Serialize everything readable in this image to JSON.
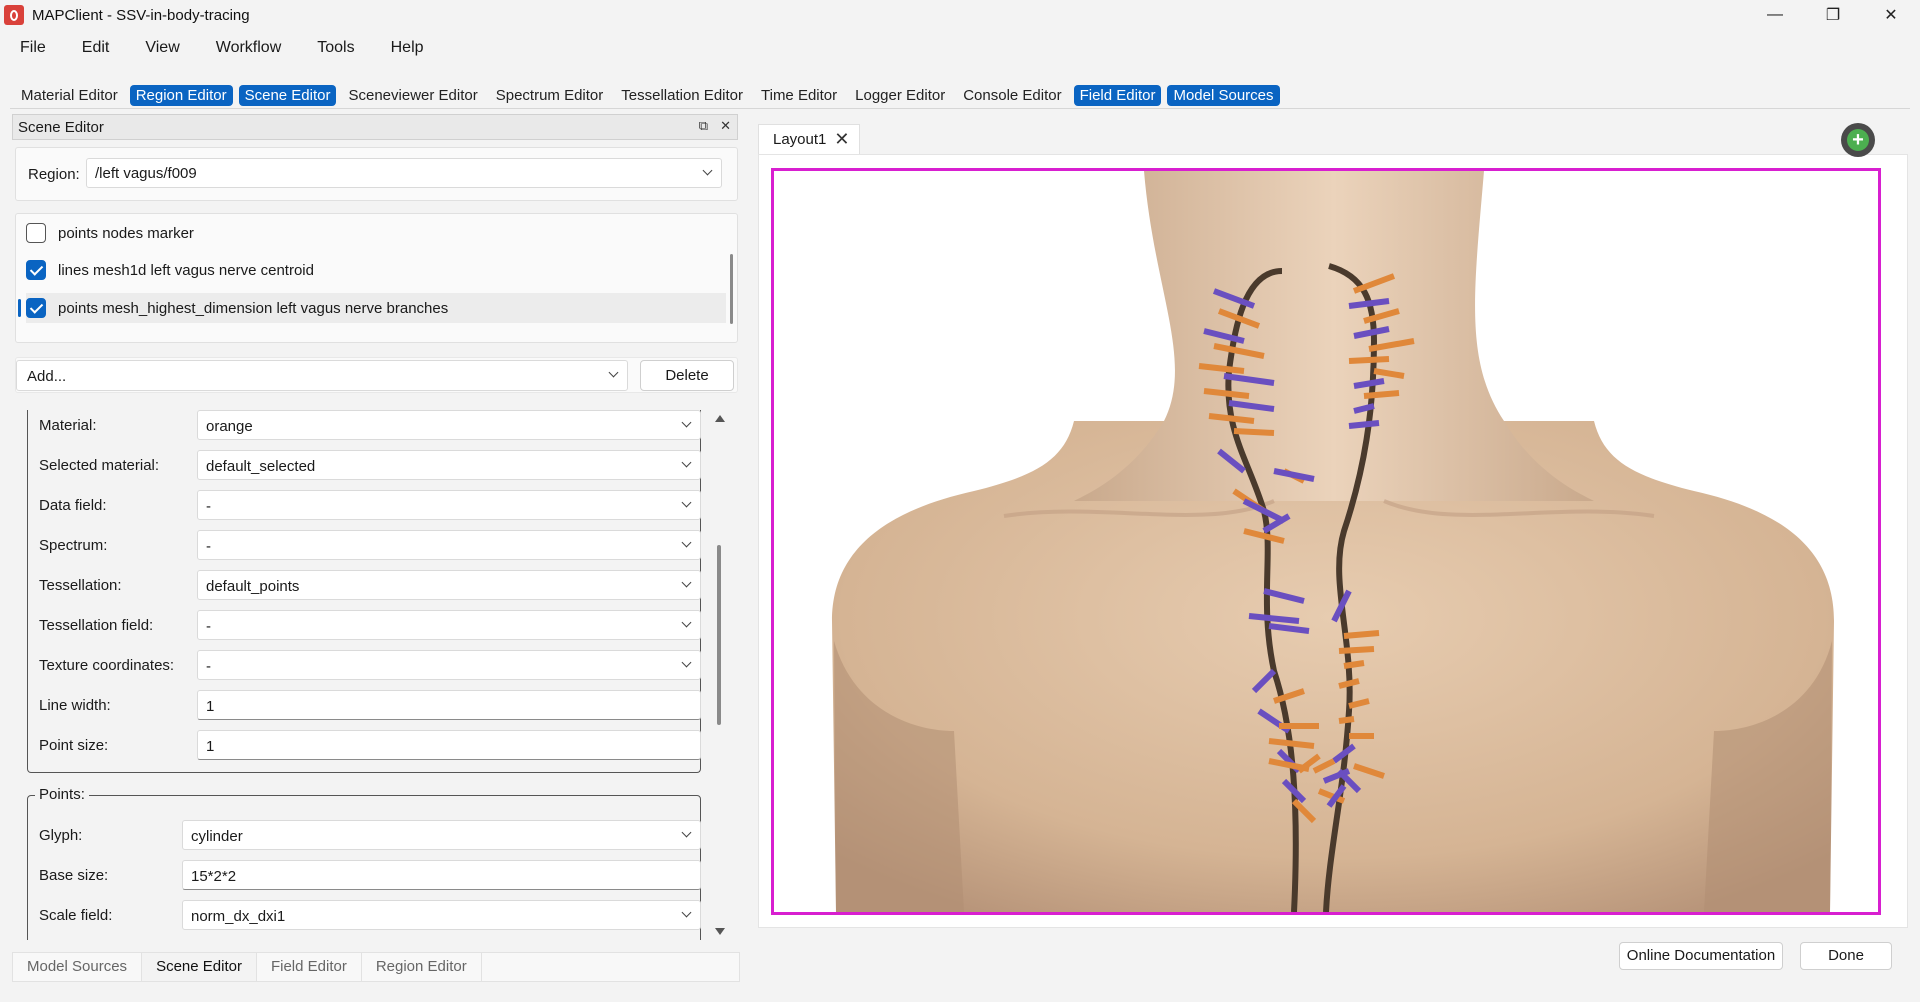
{
  "window": {
    "title": "MAPClient - SSV-in-body-tracing",
    "minimize": "—",
    "maximize": "❐",
    "close": "✕"
  },
  "menu": [
    "File",
    "Edit",
    "View",
    "Workflow",
    "Tools",
    "Help"
  ],
  "toolbar": [
    {
      "label": "Material Editor",
      "active": false
    },
    {
      "label": "Region Editor",
      "active": true
    },
    {
      "label": "Scene Editor",
      "active": true
    },
    {
      "label": "Sceneviewer Editor",
      "active": false
    },
    {
      "label": "Spectrum Editor",
      "active": false
    },
    {
      "label": "Tessellation Editor",
      "active": false
    },
    {
      "label": "Time Editor",
      "active": false
    },
    {
      "label": "Logger Editor",
      "active": false
    },
    {
      "label": "Console Editor",
      "active": false
    },
    {
      "label": "Field Editor",
      "active": true
    },
    {
      "label": "Model Sources",
      "active": true
    }
  ],
  "scene_editor": {
    "title": "Scene Editor",
    "float_icon": "⧉",
    "close_icon": "✕",
    "region_label": "Region:",
    "region_value": "/left vagus/f009",
    "graphics": [
      {
        "label": "points nodes marker",
        "checked": false
      },
      {
        "label": "lines mesh1d left vagus nerve centroid",
        "checked": true
      },
      {
        "label": "points mesh_highest_dimension left vagus nerve branches",
        "checked": true
      }
    ],
    "add_label": "Add...",
    "delete_label": "Delete",
    "fields": {
      "material": {
        "label": "Material:",
        "value": "orange"
      },
      "selected_material": {
        "label": "Selected material:",
        "value": "default_selected"
      },
      "data_field": {
        "label": "Data field:",
        "value": "-"
      },
      "spectrum": {
        "label": "Spectrum:",
        "value": "-"
      },
      "tessellation": {
        "label": "Tessellation:",
        "value": "default_points"
      },
      "tessellation_field": {
        "label": "Tessellation field:",
        "value": "-"
      },
      "texture_coordinates": {
        "label": "Texture coordinates:",
        "value": "-"
      },
      "line_width": {
        "label": "Line width:",
        "value": "1"
      },
      "point_size": {
        "label": "Point size:",
        "value": "1"
      }
    },
    "points_group": "Points:",
    "points": {
      "glyph": {
        "label": "Glyph:",
        "value": "cylinder"
      },
      "base_size": {
        "label": "Base size:",
        "value": "15*2*2"
      },
      "scale_field": {
        "label": "Scale field:",
        "value": "norm_dx_dxi1"
      }
    }
  },
  "bottom_tabs": [
    {
      "label": "Model Sources",
      "active": false
    },
    {
      "label": "Scene Editor",
      "active": true
    },
    {
      "label": "Field Editor",
      "active": false
    },
    {
      "label": "Region Editor",
      "active": false
    }
  ],
  "layout": {
    "tab_label": "Layout1",
    "tab_close": "✕",
    "add_icon": "+",
    "online_doc": "Online Documentation",
    "done": "Done"
  },
  "colors": {
    "accent": "#0a64c2",
    "viewport_border": "#d81fd0",
    "body_skin": "#d9b999",
    "nerve": "#4a3a2c",
    "branch_orange": "#e0883a",
    "branch_purple": "#6a4fc0"
  }
}
